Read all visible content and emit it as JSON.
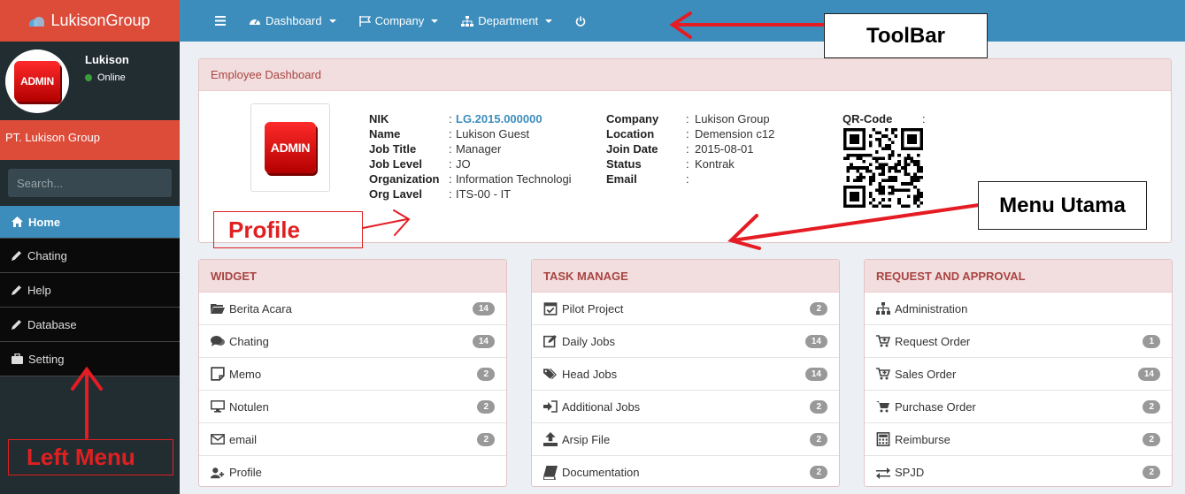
{
  "brand": {
    "name": "LukisonGroup"
  },
  "user": {
    "name": "Lukison",
    "status": "Online",
    "avatar_text": "ADMIN"
  },
  "company": "PT. Lukison Group",
  "search": {
    "placeholder": "Search..."
  },
  "menu": [
    {
      "label": "Home",
      "icon": "home-icon"
    },
    {
      "label": "Chating",
      "icon": "pencil-icon"
    },
    {
      "label": "Help",
      "icon": "pencil-icon"
    },
    {
      "label": "Database",
      "icon": "pencil-icon"
    },
    {
      "label": "Setting",
      "icon": "briefcase-icon"
    }
  ],
  "toolbar": [
    {
      "label": "Dashboard",
      "icon": "dashboard-icon"
    },
    {
      "label": "Company",
      "icon": "flag-icon"
    },
    {
      "label": "Department",
      "icon": "sitemap-icon"
    }
  ],
  "annotations": {
    "toolbar": "ToolBar",
    "profile": "Profile",
    "menu_utama": "Menu Utama",
    "left_menu": "Left Menu"
  },
  "dashboard": {
    "title": "Employee Dashboard",
    "photo_text": "ADMIN",
    "left_fields": [
      {
        "label": "NIK",
        "sep": ":",
        "value": "LG.2015.000000"
      },
      {
        "label": "Name",
        "sep": ":",
        "value": "Lukison Guest"
      },
      {
        "label": "Job Title",
        "sep": ":",
        "value": "Manager"
      },
      {
        "label": "Job Level",
        "sep": ":",
        "value": "JO"
      },
      {
        "label": "Organization",
        "sep": ":",
        "value": "Information Technologi"
      },
      {
        "label": "Org Lavel",
        "sep": ":",
        "value": "ITS-00 - IT"
      }
    ],
    "right_fields": [
      {
        "label": "Company",
        "sep": ": ",
        "value": "Lukison Group"
      },
      {
        "label": "Location",
        "sep": ": ",
        "value": "Demension c12"
      },
      {
        "label": "Join Date",
        "sep": ": ",
        "value": "2015-08-01"
      },
      {
        "label": "Status",
        "sep": ": ",
        "value": "Kontrak"
      },
      {
        "label": "Email",
        "sep": ":",
        "value": ""
      }
    ],
    "qr": {
      "label": "QR-Code",
      "sep": ":"
    }
  },
  "widget": {
    "title": "WIDGET",
    "items": [
      {
        "label": "Berita Acara",
        "badge": "14",
        "icon": "folder-open-icon"
      },
      {
        "label": "Chating",
        "badge": "14",
        "icon": "comments-icon"
      },
      {
        "label": "Memo",
        "badge": "2",
        "icon": "sticky-note-icon"
      },
      {
        "label": "Notulen",
        "badge": "2",
        "icon": "desktop-icon"
      },
      {
        "label": "email",
        "badge": "2",
        "icon": "envelope-icon"
      },
      {
        "label": "Profile",
        "badge": "",
        "icon": "user-plus-icon"
      }
    ]
  },
  "task": {
    "title": "TASK MANAGE",
    "items": [
      {
        "label": "Pilot Project",
        "badge": "2",
        "icon": "calendar-check-icon"
      },
      {
        "label": "Daily Jobs",
        "badge": "14",
        "icon": "edit-icon"
      },
      {
        "label": "Head Jobs",
        "badge": "14",
        "icon": "tags-icon"
      },
      {
        "label": "Additional Jobs",
        "badge": "2",
        "icon": "sign-in-icon"
      },
      {
        "label": "Arsip File",
        "badge": "2",
        "icon": "upload-icon"
      },
      {
        "label": "Documentation",
        "badge": "2",
        "icon": "book-icon"
      }
    ]
  },
  "request": {
    "title": "REQUEST AND APPROVAL",
    "items": [
      {
        "label": "Administration",
        "badge": "",
        "icon": "sitemap-icon"
      },
      {
        "label": "Request Order",
        "badge": "1",
        "icon": "cart-plus-icon"
      },
      {
        "label": "Sales Order",
        "badge": "14",
        "icon": "cart-plus-icon"
      },
      {
        "label": "Purchase Order",
        "badge": "2",
        "icon": "shopping-cart-icon"
      },
      {
        "label": "Reimburse",
        "badge": "2",
        "icon": "calculator-icon"
      },
      {
        "label": "SPJD",
        "badge": "2",
        "icon": "exchange-icon"
      }
    ]
  }
}
